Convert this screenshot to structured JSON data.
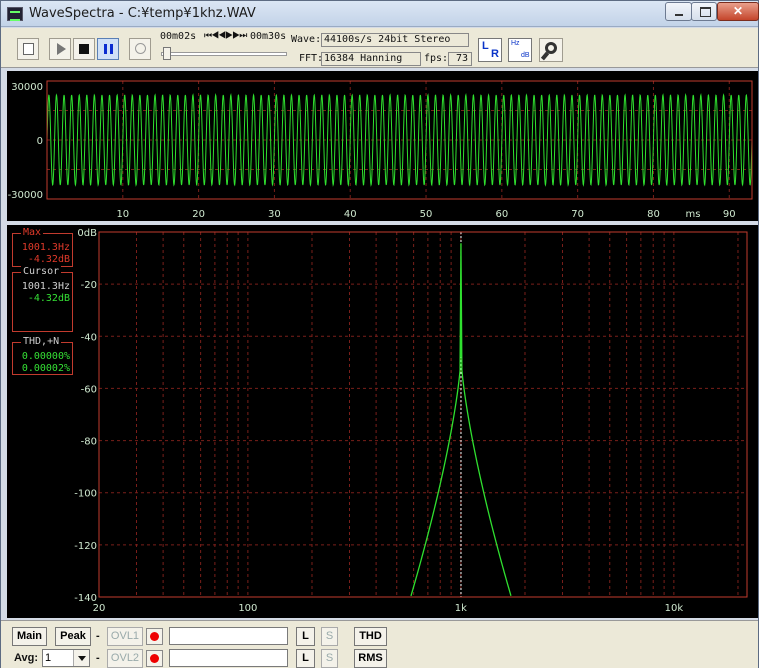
{
  "window": {
    "title": "WaveSpectra - C:¥temp¥1khz.WAV"
  },
  "toolbar": {
    "position_start": "00m02s",
    "position_end": "00m30s",
    "transport_arrows": "⏮◀◀▶▶⏭",
    "seek_fraction": 0.02,
    "wave_label": "Wave:",
    "wave_value": "44100s/s 24bit Stereo",
    "fft_label": "FFT:",
    "fft_value": "16384 Hanning",
    "fps_label": "fps:",
    "fps_value": "73",
    "lr_left": "L",
    "lr_right": "R",
    "hz_label": "Hz",
    "db_label": "dB",
    "icons": [
      "open-icon",
      "play-icon",
      "stop-icon",
      "pause-icon",
      "loop-icon",
      "lr-icon",
      "hz-db-icon",
      "settings-icon"
    ]
  },
  "waveform": {
    "y_ticks": [
      "30000",
      "0",
      "-30000"
    ],
    "x_ticks": [
      "10",
      "20",
      "30",
      "40",
      "50",
      "60",
      "70",
      "80",
      "90"
    ],
    "x_unit": "ms",
    "colors": {
      "trace": "#2fe02f",
      "grid": "#7a1f1a",
      "frame": "#c23b2e",
      "text": "#cfe8cf"
    },
    "frequency_hz": 1000,
    "amplitude": 25000,
    "y_range": [
      -32768,
      32767
    ],
    "x_range_ms": [
      0,
      93
    ]
  },
  "spectrum": {
    "y_ticks": [
      "0dB",
      "-20",
      "-40",
      "-60",
      "-80",
      "-100",
      "-120",
      "-140"
    ],
    "x_ticks": [
      "20",
      "100",
      "1k",
      "10k"
    ],
    "max_box": {
      "label": "Max",
      "freq": "1001.3Hz",
      "level": "-4.32dB"
    },
    "cursor_box": {
      "label": "Cursor",
      "freq": "1001.3Hz",
      "level": "-4.32dB"
    },
    "thd_box": {
      "label": "THD,+N",
      "thd": "0.00000%",
      "thdn": "0.00002%"
    },
    "cursor_freq_hz": 1001.3,
    "peak_db": -4.32,
    "db_range": [
      -140,
      0
    ],
    "freq_range_hz": [
      20,
      22050
    ],
    "colors": {
      "trace": "#2fe02f",
      "grid": "#7a1f1a",
      "frame": "#c23b2e",
      "text": "#cfe8cf",
      "cursor": "#ffffff"
    }
  },
  "bottombar": {
    "main": "Main",
    "peak": "Peak",
    "dash1": "-",
    "dash2": "-",
    "ovl1": "OVL1",
    "ovl2": "OVL2",
    "avg_label": "Avg:",
    "avg_value": "1",
    "l1": "L",
    "s1": "S",
    "l2": "L",
    "s2": "S",
    "thd": "THD",
    "rms": "RMS"
  }
}
